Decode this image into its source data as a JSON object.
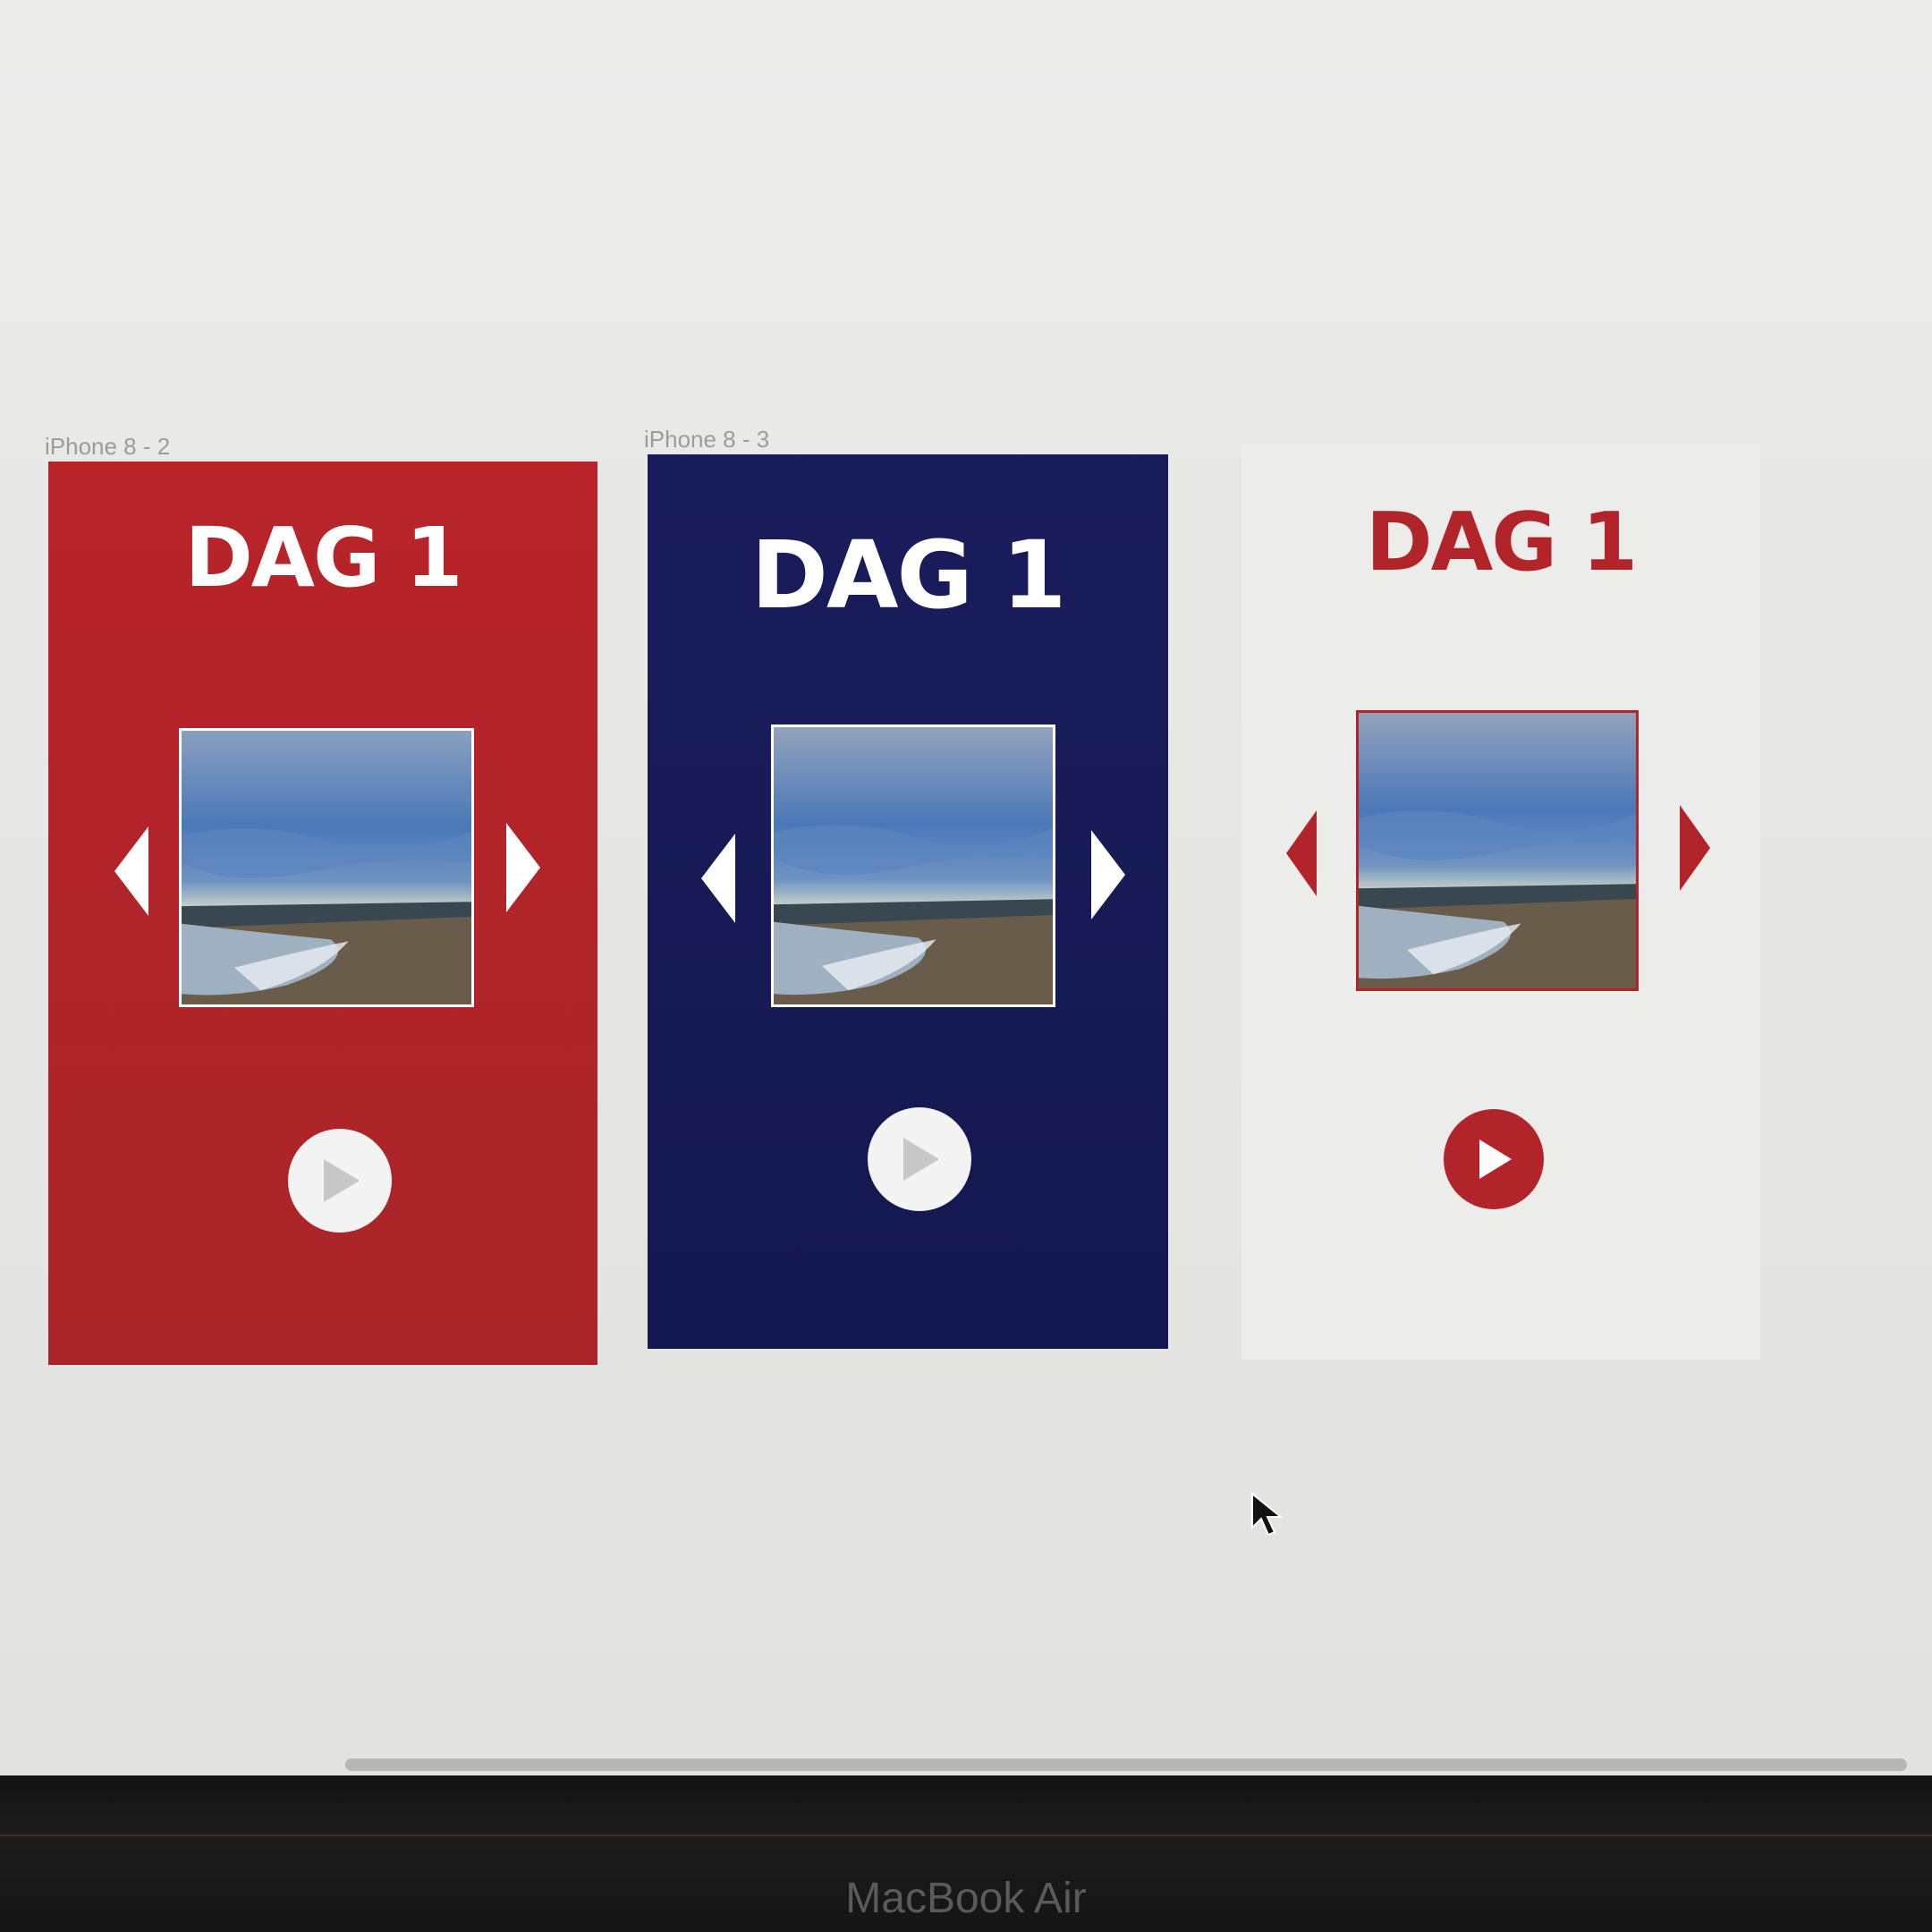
{
  "artboards": [
    {
      "label": "iPhone 8 - 2",
      "title": "DAG 1",
      "background": "#b1252a",
      "title_color": "#ffffff",
      "arrow_color": "#ffffff",
      "play_bg": "#f3f3f3",
      "play_icon_color": "#c7c7c7",
      "photo_border": "#ffffff",
      "icons": {
        "prev": "triangle-left-icon",
        "next": "triangle-right-icon",
        "play": "play-icon"
      }
    },
    {
      "label": "iPhone 8 - 3",
      "title": "DAG 1",
      "background": "#181b56",
      "title_color": "#ffffff",
      "arrow_color": "#ffffff",
      "play_bg": "#f3f3f3",
      "play_icon_color": "#c7c7c7",
      "photo_border": "#ffffff",
      "icons": {
        "prev": "triangle-left-icon",
        "next": "triangle-right-icon",
        "play": "play-icon"
      }
    },
    {
      "label": "",
      "title": "DAG 1",
      "background": "#ececea",
      "title_color": "#b1252a",
      "arrow_color": "#b1252a",
      "play_bg": "#b1252a",
      "play_icon_color": "#ffffff",
      "photo_border": "#b1252a",
      "icons": {
        "prev": "triangle-left-icon",
        "next": "triangle-right-icon",
        "play": "play-icon"
      }
    }
  ],
  "device": {
    "brand": "MacBook Air"
  },
  "cursor": {
    "icon": "mouse-pointer-icon"
  }
}
